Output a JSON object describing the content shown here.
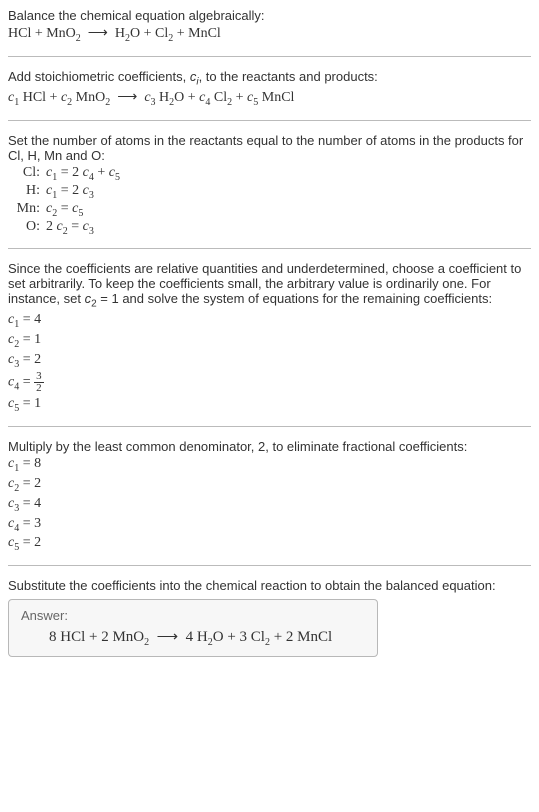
{
  "intro": {
    "line1": "Balance the chemical equation algebraically:",
    "eq": "HCl + MnO₂  ⟶  H₂O + Cl₂ + MnCl"
  },
  "step1": {
    "text": "Add stoichiometric coefficients, cᵢ, to the reactants and products:",
    "eq": "c₁ HCl + c₂ MnO₂  ⟶  c₃ H₂O + c₄ Cl₂ + c₅ MnCl"
  },
  "step2": {
    "text": "Set the number of atoms in the reactants equal to the number of atoms in the products for Cl, H, Mn and O:",
    "rows": [
      {
        "label": "Cl:",
        "eq": "c₁ = 2 c₄ + c₅"
      },
      {
        "label": "H:",
        "eq": "c₁ = 2 c₃"
      },
      {
        "label": "Mn:",
        "eq": "c₂ = c₅"
      },
      {
        "label": "O:",
        "eq": "2 c₂ = c₃"
      }
    ]
  },
  "step3": {
    "text": "Since the coefficients are relative quantities and underdetermined, choose a coefficient to set arbitrarily. To keep the coefficients small, the arbitrary value is ordinarily one. For instance, set c₂ = 1 and solve the system of equations for the remaining coefficients:",
    "coeffs": [
      "c₁ = 4",
      "c₂ = 1",
      "c₃ = 2"
    ],
    "c4prefix": "c₄ = ",
    "c4num": "3",
    "c4den": "2",
    "c5": "c₅ = 1"
  },
  "step4": {
    "text": "Multiply by the least common denominator, 2, to eliminate fractional coefficients:",
    "coeffs": [
      "c₁ = 8",
      "c₂ = 2",
      "c₃ = 4",
      "c₄ = 3",
      "c₅ = 2"
    ]
  },
  "final": {
    "text": "Substitute the coefficients into the chemical reaction to obtain the balanced equation:"
  },
  "answer": {
    "label": "Answer:",
    "eq": "8 HCl + 2 MnO₂  ⟶  4 H₂O + 3 Cl₂ + 2 MnCl"
  },
  "chart_data": {
    "type": "table",
    "title": "Balancing HCl + MnO2 → H2O + Cl2 + MnCl",
    "atom_balance": {
      "Cl": "c1 = 2 c4 + c5",
      "H": "c1 = 2 c3",
      "Mn": "c2 = c5",
      "O": "2 c2 = c3"
    },
    "initial_solution": {
      "c1": 4,
      "c2": 1,
      "c3": 2,
      "c4": 1.5,
      "c5": 1
    },
    "scaled_solution": {
      "c1": 8,
      "c2": 2,
      "c3": 4,
      "c4": 3,
      "c5": 2
    },
    "balanced_equation": "8 HCl + 2 MnO2 → 4 H2O + 3 Cl2 + 2 MnCl"
  }
}
